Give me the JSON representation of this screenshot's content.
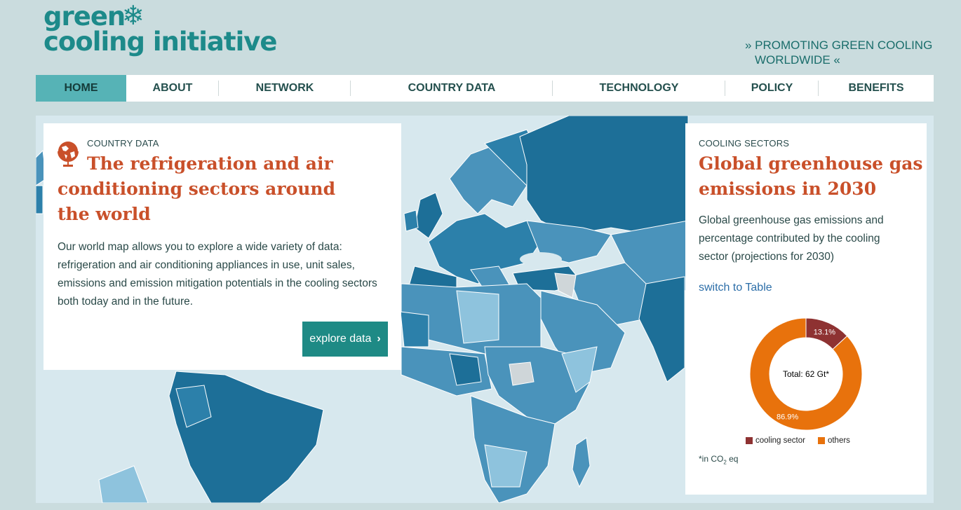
{
  "header": {
    "logo_line1": "green",
    "logo_line2": "cooling initiative",
    "tagline_line1": "» PROMOTING GREEN COOLING",
    "tagline_line2": "WORLDWIDE «"
  },
  "nav": {
    "items": [
      {
        "label": "HOME",
        "active": true
      },
      {
        "label": "ABOUT"
      },
      {
        "label": "NETWORK"
      },
      {
        "label": "COUNTRY DATA"
      },
      {
        "label": "TECHNOLOGY"
      },
      {
        "label": "POLICY"
      },
      {
        "label": "BENEFITS"
      }
    ]
  },
  "country_card": {
    "kicker": "COUNTRY DATA",
    "title": "The refrigeration and air conditioning sectors around the world",
    "body": "Our world map allows you to explore a wide variety of data: refrigeration and air conditioning appliances in use, unit sales, emissions and emission mitigation potentials in the cooling sectors both today and in the future.",
    "button_label": "explore data",
    "icon": "globe-icon"
  },
  "sectors_card": {
    "kicker": "COOLING SECTORS",
    "title": "Global greenhouse gas emissions in 2030",
    "body": "Global greenhouse gas emissions and percentage contributed by the cooling sector (projections for 2030)",
    "switch_label": "switch to Table",
    "footnote_pre": "*in CO",
    "footnote_sub": "2",
    "footnote_post": " eq"
  },
  "chart_data": {
    "type": "pie",
    "center_label": "Total: 62 Gt*",
    "slices": [
      {
        "name": "cooling sector",
        "value": 13.1,
        "label": "13.1%",
        "color": "#8e3232"
      },
      {
        "name": "others",
        "value": 86.9,
        "label": "86.9%",
        "color": "#e8720c"
      }
    ],
    "legend_placement": "bottom"
  },
  "colors": {
    "brand": "#1d8a8a",
    "accent_title": "#c9502a",
    "nav_active": "#56b3b6",
    "button": "#1e8a85",
    "map_water": "#d7e8ee",
    "map_land_dark": "#1d6f98",
    "map_land_mid": "#4a93bb",
    "map_land_light": "#8ec3dd"
  }
}
